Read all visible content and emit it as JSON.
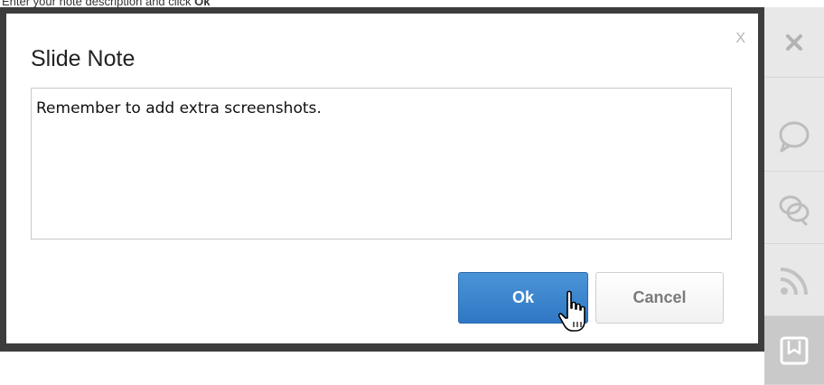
{
  "instruction": {
    "prefix": "Enter your note description and click ",
    "emphasis": "Ok"
  },
  "dialog": {
    "title": "Slide Note",
    "close_label": "X",
    "note_text": "Remember to add extra screenshots.",
    "ok_label": "Ok",
    "cancel_label": "Cancel"
  },
  "sidebar": {
    "icons": [
      "close-icon",
      "comment-icon",
      "comments-icon",
      "rss-icon",
      "bookmark-icon"
    ]
  },
  "colors": {
    "ok_button": "#3a84cd",
    "dialog_border": "#3d3d3d",
    "sidebar_bg": "#e8e8e8"
  }
}
